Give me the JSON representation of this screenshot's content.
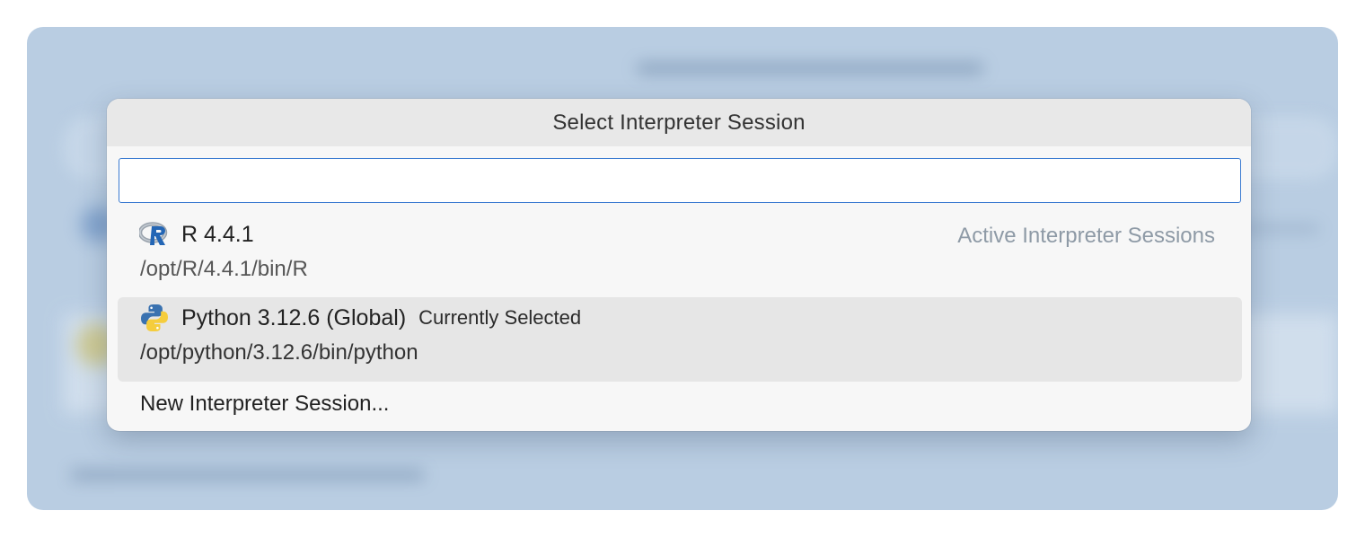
{
  "dialog": {
    "title": "Select Interpreter Session"
  },
  "search": {
    "value": "",
    "placeholder": ""
  },
  "sessions": [
    {
      "icon": "r-logo-icon",
      "name": "R 4.4.1",
      "path": "/opt/R/4.4.1/bin/R",
      "group_label": "Active Interpreter Sessions",
      "selected": false
    },
    {
      "icon": "python-logo-icon",
      "name": "Python 3.12.6 (Global)",
      "tag": "Currently Selected",
      "path": "/opt/python/3.12.6/bin/python",
      "selected": true
    }
  ],
  "new_session": {
    "label": "New Interpreter Session..."
  },
  "colors": {
    "backdrop": "#b9cde2",
    "dialog_bg": "#f7f7f7",
    "title_bar": "#e8e8e8",
    "selected_row": "#e6e6e6",
    "focus_border": "#3b7bd1",
    "group_label": "#8e9aa6"
  }
}
